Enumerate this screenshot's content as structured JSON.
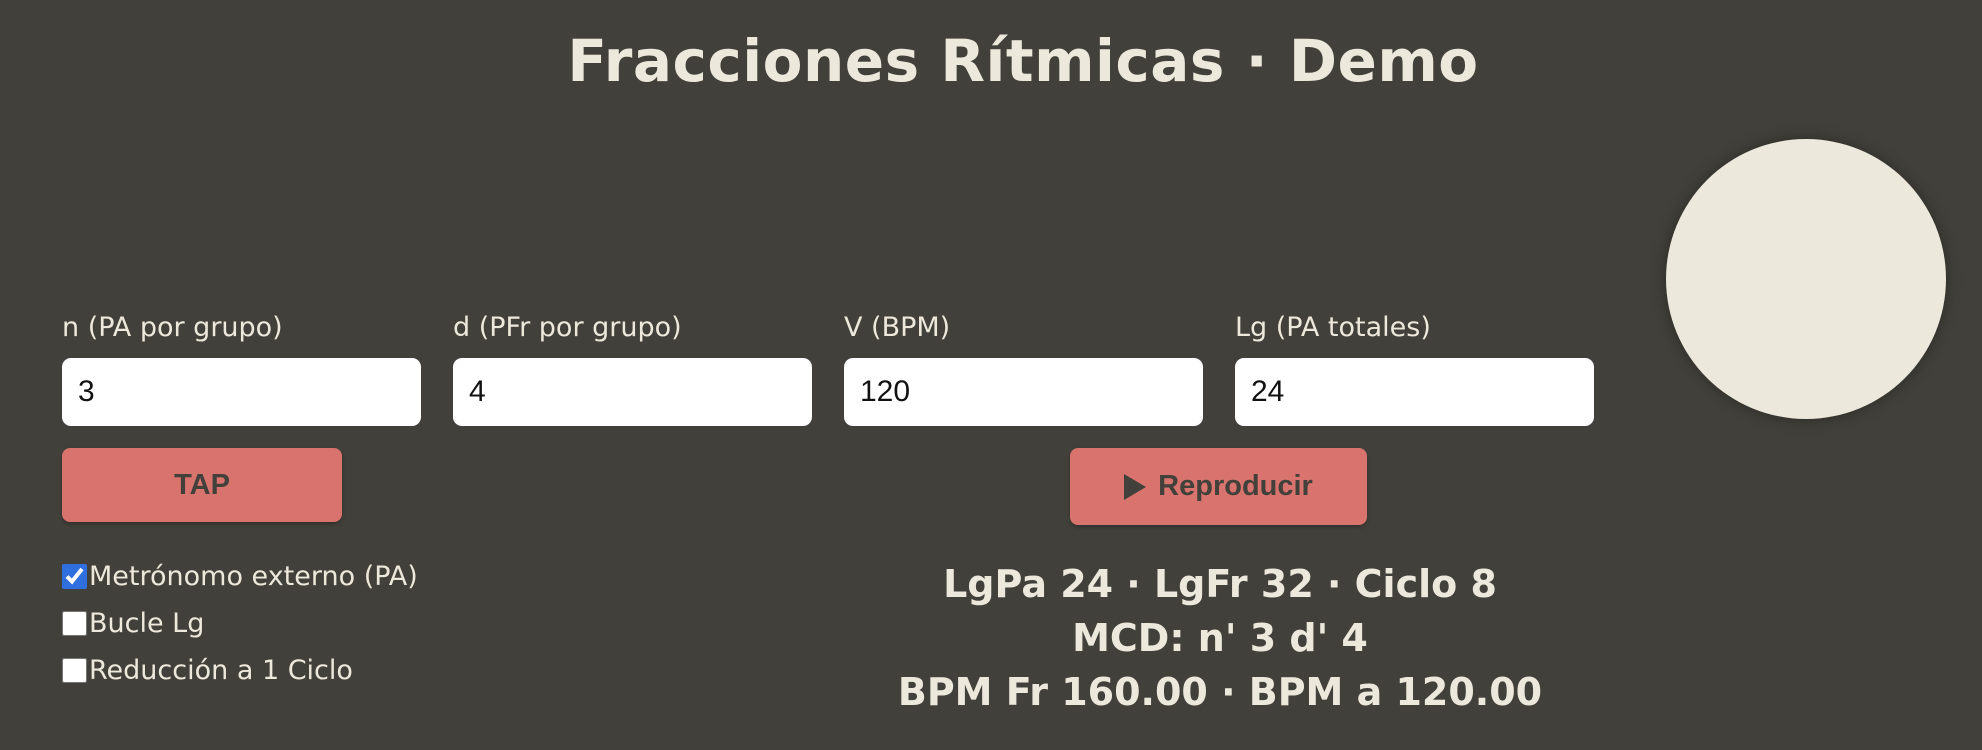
{
  "header": {
    "title": "Fracciones Rítmicas · Demo"
  },
  "fields": [
    {
      "label": "n (PA por grupo)",
      "value": "3"
    },
    {
      "label": "d (PFr por grupo)",
      "value": "4"
    },
    {
      "label": "V (BPM)",
      "value": "120"
    },
    {
      "label": "Lg (PA totales)",
      "value": "24"
    }
  ],
  "buttons": {
    "tap_label": "TAP",
    "play_label": "Reproducir",
    "play_icon": "play-triangle-icon"
  },
  "options": [
    {
      "label": "Metrónomo externo (PA)",
      "checked": true
    },
    {
      "label": "Bucle Lg",
      "checked": false
    },
    {
      "label": "Reducción a 1 Ciclo",
      "checked": false
    }
  ],
  "stats": {
    "line1": "LgPa 24 · LgFr 32 · Ciclo 8",
    "line2": "MCD: n' 3 d' 4",
    "line3": "BPM Fr 160.00 · BPM a 120.00"
  },
  "colors": {
    "background": "#41403a",
    "text": "#ede8dc",
    "accent": "#d9736d",
    "indicator": "#ede8dc"
  }
}
